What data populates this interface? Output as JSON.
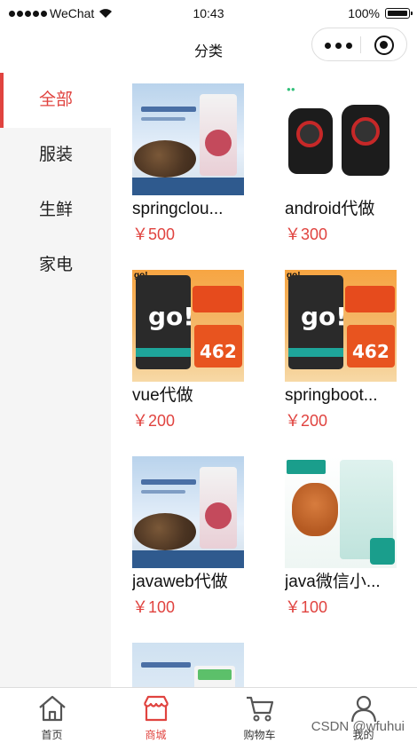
{
  "status_bar": {
    "carrier": "WeChat",
    "time": "10:43",
    "battery": "100%"
  },
  "nav": {
    "title": "分类"
  },
  "sidebar": {
    "items": [
      {
        "label": "全部",
        "active": true
      },
      {
        "label": "服装",
        "active": false
      },
      {
        "label": "生鲜",
        "active": false
      },
      {
        "label": "家电",
        "active": false
      }
    ]
  },
  "products": [
    {
      "name": "springclou...",
      "price": "￥500",
      "thumb": "dog-food-beef"
    },
    {
      "name": "android代做",
      "price": "￥300",
      "thumb": "speakers"
    },
    {
      "name": "vue代做",
      "price": "￥200",
      "thumb": "go-dog-food"
    },
    {
      "name": "springboot...",
      "price": "￥200",
      "thumb": "go-dog-food"
    },
    {
      "name": "javaweb代做",
      "price": "￥100",
      "thumb": "dog-food-beef"
    },
    {
      "name": "java微信小...",
      "price": "￥100",
      "thumb": "poodle-dog-food"
    },
    {
      "name": "",
      "price": "",
      "thumb": "dog-food-box"
    }
  ],
  "tabbar": {
    "items": [
      {
        "label": "首页",
        "icon": "home-icon",
        "active": false
      },
      {
        "label": "商城",
        "icon": "shop-icon",
        "active": true
      },
      {
        "label": "购物车",
        "icon": "cart-icon",
        "active": false
      },
      {
        "label": "我的",
        "icon": "user-icon",
        "active": false
      }
    ]
  },
  "colors": {
    "accent": "#e0433f",
    "sidebar_bg": "#f5f5f5"
  },
  "watermark": "CSDN @wfuhui"
}
